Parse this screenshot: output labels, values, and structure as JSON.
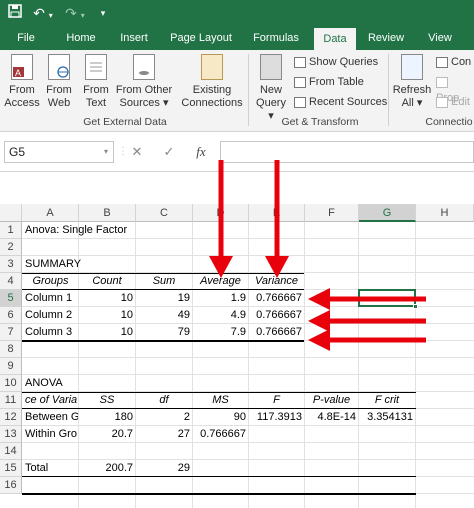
{
  "qat": {
    "save_icon": "save-icon",
    "undo_icon": "undo-icon",
    "redo_icon": "redo-icon",
    "customize_icon": "customize-icon"
  },
  "tabs": [
    {
      "label": "File"
    },
    {
      "label": "Home"
    },
    {
      "label": "Insert"
    },
    {
      "label": "Page Layout"
    },
    {
      "label": "Formulas"
    },
    {
      "label": "Data"
    },
    {
      "label": "Review"
    },
    {
      "label": "View"
    }
  ],
  "ribbon": {
    "from_access": "From\nAccess",
    "from_access_l1": "From",
    "from_access_l2": "Access",
    "from_web_l1": "From",
    "from_web_l2": "Web",
    "from_text_l1": "From",
    "from_text_l2": "Text",
    "from_other_l1": "From Other",
    "from_other_l2": "Sources ▾",
    "existing_l1": "Existing",
    "existing_l2": "Connections",
    "group_external": "Get External Data",
    "new_query_l1": "New",
    "new_query_l2": "Query ▾",
    "show_queries": "Show Queries",
    "from_table": "From Table",
    "recent_sources": "Recent Sources",
    "group_transform": "Get & Transform",
    "refresh_l1": "Refresh",
    "refresh_l2": "All ▾",
    "connections": "Con",
    "properties": "Prop",
    "edit_links": "Edit",
    "group_connections": "Connectio"
  },
  "formula_bar": {
    "name_box": "G5",
    "cancel": "✕",
    "enter": "✓",
    "fx": "fx",
    "value": ""
  },
  "columns": [
    "A",
    "B",
    "C",
    "D",
    "E",
    "F",
    "G",
    "H"
  ],
  "rows": [
    "1",
    "2",
    "3",
    "4",
    "5",
    "6",
    "7",
    "8",
    "9",
    "10",
    "11",
    "12",
    "13",
    "14",
    "15",
    "16"
  ],
  "cells": {
    "r1": {
      "a": "Anova: Single Factor"
    },
    "r3": {
      "a": "SUMMARY"
    },
    "r4": {
      "a": "Groups",
      "b": "Count",
      "c": "Sum",
      "d": "Average",
      "e": "Variance"
    },
    "r5": {
      "a": "Column 1",
      "b": "10",
      "c": "19",
      "d": "1.9",
      "e": "0.766667"
    },
    "r6": {
      "a": "Column 2",
      "b": "10",
      "c": "49",
      "d": "4.9",
      "e": "0.766667"
    },
    "r7": {
      "a": "Column 3",
      "b": "10",
      "c": "79",
      "d": "7.9",
      "e": "0.766667"
    },
    "r10": {
      "a": "ANOVA"
    },
    "r11": {
      "a": "ce of Varia",
      "b": "SS",
      "c": "df",
      "d": "MS",
      "e": "F",
      "f": "P-value",
      "g": "F crit"
    },
    "r12": {
      "a": "Between G",
      "b": "180",
      "c": "2",
      "d": "90",
      "e": "117.3913",
      "f": "4.8E-14",
      "g": "3.354131"
    },
    "r13": {
      "a": "Within Gro",
      "b": "20.7",
      "c": "27",
      "d": "0.766667"
    },
    "r15": {
      "a": "Total",
      "b": "200.7",
      "c": "29"
    }
  },
  "selected_cell": "G5",
  "arrow_color": "#e8000b"
}
